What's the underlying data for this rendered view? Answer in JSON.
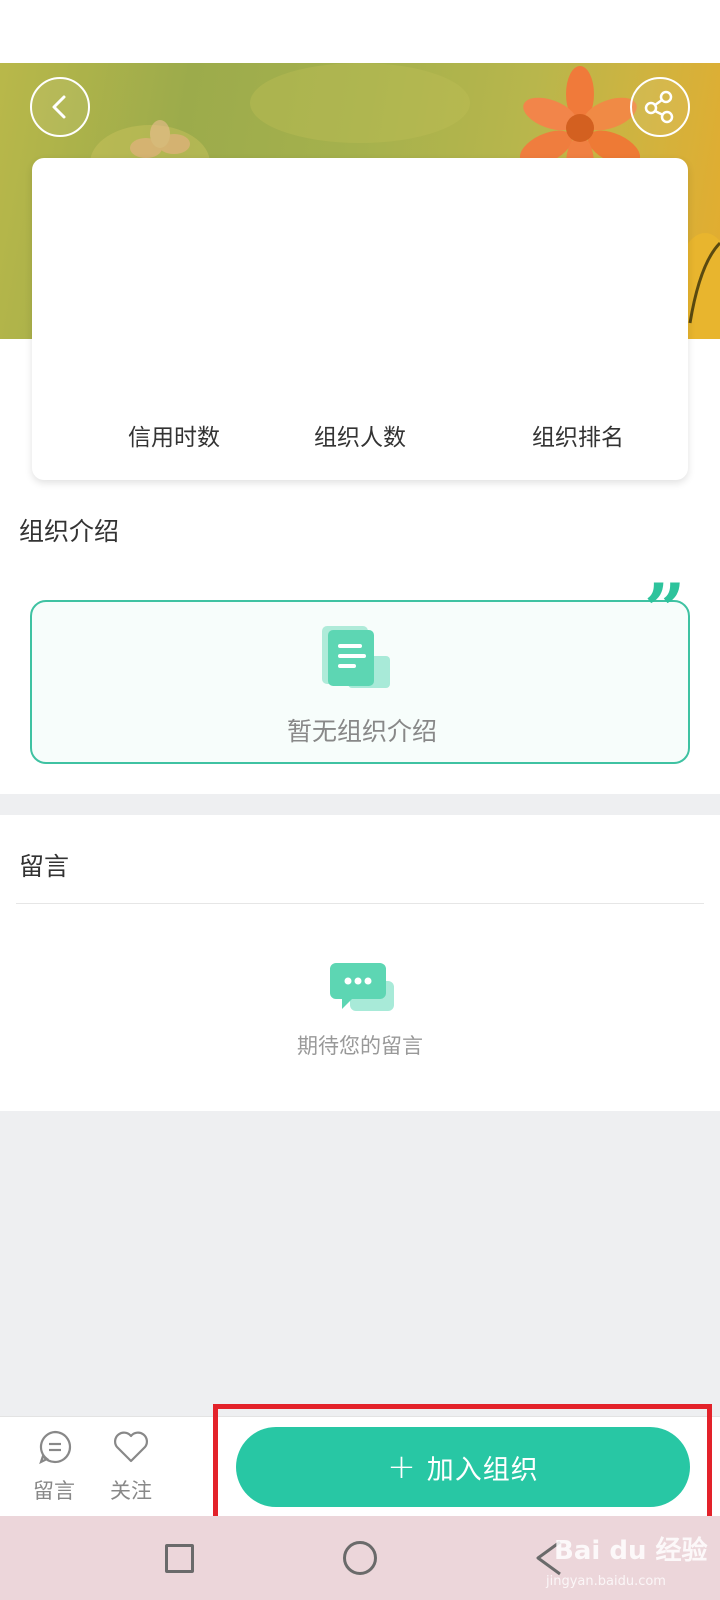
{
  "stats": {
    "credit_hours_label": "信用时数",
    "member_count_label": "组织人数",
    "ranking_label": "组织排名"
  },
  "intro": {
    "title": "组织介绍",
    "empty_text": "暂无组织介绍"
  },
  "messages": {
    "title": "留言",
    "empty_text": "期待您的留言"
  },
  "bottom_bar": {
    "message_label": "留言",
    "follow_label": "关注",
    "join_label": "加入组织",
    "join_plus": "+"
  },
  "watermark": {
    "logo": "Bai du 经验",
    "url": "jingyan.baidu.com"
  },
  "colors": {
    "accent": "#28c7a4",
    "highlight_border": "#e3222a"
  },
  "icons": [
    "back-arrow-icon",
    "share-icon",
    "document-icon",
    "quote-icon",
    "chat-bubble-icon",
    "message-icon",
    "heart-icon",
    "plus-icon",
    "nav-square-icon",
    "nav-home-icon",
    "nav-back-icon"
  ]
}
